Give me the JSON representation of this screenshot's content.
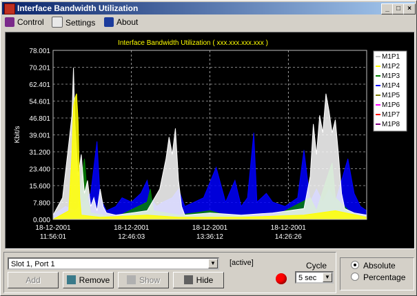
{
  "window": {
    "title": "Interface Bandwidth Utilization",
    "controls": [
      "_",
      "□",
      "×"
    ]
  },
  "menu": {
    "items": [
      {
        "label": "Control",
        "icon": "network-icon"
      },
      {
        "label": "Settings",
        "icon": "settings-icon"
      },
      {
        "label": "About",
        "icon": "book-icon"
      }
    ]
  },
  "chart_data": {
    "type": "area",
    "title": "Interface Bandwidth Utilization ( xxx.xxx.xxx.xxx )",
    "ylabel": "Kbit/s",
    "ylim": [
      0,
      78.001
    ],
    "yticks": [
      "78.001",
      "70.201",
      "62.401",
      "54.601",
      "46.801",
      "39.001",
      "31.200",
      "23.400",
      "15.600",
      "7.800",
      "0.000"
    ],
    "xticks": [
      {
        "date": "18-12-2001",
        "time": "11:56:01"
      },
      {
        "date": "18-12-2001",
        "time": "12:46:03"
      },
      {
        "date": "18-12-2001",
        "time": "13:36:12"
      },
      {
        "date": "18-12-2001",
        "time": "14:26:26"
      }
    ],
    "grid": true,
    "legend_position": "top-right",
    "series": [
      {
        "name": "M1P1",
        "color": "#ffffff",
        "points": [
          [
            0.0,
            2
          ],
          [
            0.03,
            10
          ],
          [
            0.05,
            35
          ],
          [
            0.06,
            48
          ],
          [
            0.065,
            70
          ],
          [
            0.07,
            44
          ],
          [
            0.08,
            20
          ],
          [
            0.09,
            30
          ],
          [
            0.1,
            12
          ],
          [
            0.11,
            18
          ],
          [
            0.12,
            6
          ],
          [
            0.13,
            10
          ],
          [
            0.14,
            4
          ],
          [
            0.15,
            14
          ],
          [
            0.16,
            6
          ],
          [
            0.17,
            3
          ],
          [
            0.2,
            2
          ],
          [
            0.25,
            3
          ],
          [
            0.3,
            4
          ],
          [
            0.34,
            14
          ],
          [
            0.36,
            28
          ],
          [
            0.37,
            38
          ],
          [
            0.38,
            30
          ],
          [
            0.39,
            42
          ],
          [
            0.4,
            18
          ],
          [
            0.41,
            6
          ],
          [
            0.42,
            2
          ],
          [
            0.5,
            3
          ],
          [
            0.6,
            2
          ],
          [
            0.7,
            3
          ],
          [
            0.8,
            5
          ],
          [
            0.82,
            20
          ],
          [
            0.83,
            44
          ],
          [
            0.84,
            30
          ],
          [
            0.85,
            48
          ],
          [
            0.86,
            40
          ],
          [
            0.87,
            58
          ],
          [
            0.88,
            50
          ],
          [
            0.89,
            40
          ],
          [
            0.9,
            46
          ],
          [
            0.91,
            30
          ],
          [
            0.92,
            12
          ],
          [
            0.93,
            5
          ],
          [
            0.96,
            3
          ],
          [
            1.0,
            2
          ]
        ]
      },
      {
        "name": "M1P2",
        "color": "#ffff00",
        "points": [
          [
            0.0,
            0
          ],
          [
            0.05,
            4
          ],
          [
            0.06,
            30
          ],
          [
            0.065,
            52
          ],
          [
            0.07,
            56
          ],
          [
            0.075,
            58
          ],
          [
            0.08,
            45
          ],
          [
            0.085,
            10
          ],
          [
            0.09,
            2
          ],
          [
            0.15,
            1
          ],
          [
            0.3,
            2
          ],
          [
            0.4,
            1
          ],
          [
            0.6,
            1
          ],
          [
            0.8,
            2
          ],
          [
            0.9,
            4
          ],
          [
            1.0,
            1
          ]
        ]
      },
      {
        "name": "M1P3",
        "color": "#008000",
        "points": [
          [
            0.0,
            0
          ],
          [
            0.08,
            4
          ],
          [
            0.09,
            18
          ],
          [
            0.1,
            28
          ],
          [
            0.11,
            10
          ],
          [
            0.12,
            3
          ],
          [
            0.2,
            1
          ],
          [
            0.3,
            8
          ],
          [
            0.31,
            14
          ],
          [
            0.32,
            4
          ],
          [
            0.4,
            2
          ],
          [
            0.5,
            4
          ],
          [
            0.55,
            2
          ],
          [
            0.7,
            1
          ],
          [
            0.82,
            10
          ],
          [
            0.84,
            4
          ],
          [
            0.88,
            22
          ],
          [
            0.89,
            26
          ],
          [
            0.9,
            10
          ],
          [
            0.95,
            3
          ],
          [
            1.0,
            1
          ]
        ]
      },
      {
        "name": "M1P4",
        "color": "#0000ff",
        "points": [
          [
            0.0,
            2
          ],
          [
            0.04,
            6
          ],
          [
            0.07,
            4
          ],
          [
            0.1,
            8
          ],
          [
            0.12,
            12
          ],
          [
            0.14,
            36
          ],
          [
            0.15,
            10
          ],
          [
            0.17,
            4
          ],
          [
            0.2,
            6
          ],
          [
            0.22,
            10
          ],
          [
            0.25,
            8
          ],
          [
            0.28,
            12
          ],
          [
            0.3,
            18
          ],
          [
            0.31,
            10
          ],
          [
            0.33,
            6
          ],
          [
            0.35,
            8
          ],
          [
            0.38,
            10
          ],
          [
            0.4,
            14
          ],
          [
            0.42,
            6
          ],
          [
            0.45,
            8
          ],
          [
            0.48,
            10
          ],
          [
            0.52,
            24
          ],
          [
            0.55,
            8
          ],
          [
            0.58,
            18
          ],
          [
            0.6,
            6
          ],
          [
            0.62,
            10
          ],
          [
            0.64,
            40
          ],
          [
            0.65,
            8
          ],
          [
            0.68,
            12
          ],
          [
            0.7,
            8
          ],
          [
            0.74,
            6
          ],
          [
            0.78,
            10
          ],
          [
            0.8,
            32
          ],
          [
            0.82,
            8
          ],
          [
            0.84,
            14
          ],
          [
            0.86,
            8
          ],
          [
            0.88,
            14
          ],
          [
            0.9,
            8
          ],
          [
            0.92,
            18
          ],
          [
            0.94,
            28
          ],
          [
            0.96,
            12
          ],
          [
            0.98,
            6
          ],
          [
            1.0,
            4
          ]
        ]
      },
      {
        "name": "M1P5",
        "color": "#808000",
        "points": [
          [
            0.0,
            0
          ],
          [
            0.3,
            2
          ],
          [
            0.5,
            1
          ],
          [
            0.8,
            1
          ],
          [
            1.0,
            0
          ]
        ]
      },
      {
        "name": "M1P6",
        "color": "#ff00ff",
        "points": [
          [
            0.0,
            0
          ],
          [
            0.5,
            1
          ],
          [
            1.0,
            0
          ]
        ]
      },
      {
        "name": "M1P7",
        "color": "#ff0000",
        "points": [
          [
            0.0,
            0
          ],
          [
            0.5,
            0.5
          ],
          [
            1.0,
            0
          ]
        ]
      },
      {
        "name": "M1P8",
        "color": "#800080",
        "points": [
          [
            0.0,
            0
          ],
          [
            1.0,
            0.3
          ]
        ]
      }
    ]
  },
  "controls": {
    "interface_select": "Slot 1, Port 1",
    "status": "[active]",
    "buttons": {
      "add": "Add",
      "remove": "Remove",
      "show": "Show",
      "hide": "Hide"
    },
    "cycle_label": "Cycle",
    "cycle_value": "5 sec",
    "mode": {
      "absolute": "Absolute",
      "percentage": "Percentage",
      "selected": "absolute"
    }
  }
}
